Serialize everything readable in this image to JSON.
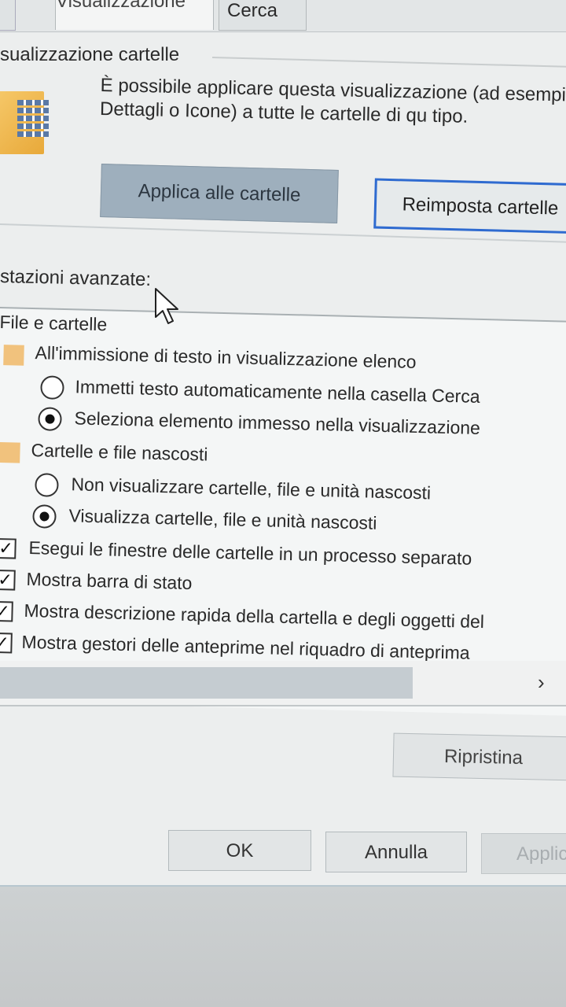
{
  "tabs": [
    {
      "label": ""
    },
    {
      "label": "Visualizzazione"
    },
    {
      "label": "Cerca"
    }
  ],
  "folder_views": {
    "title": "sualizzazione cartelle",
    "description": "È possibile applicare questa visualizzazione (ad esempio Dettagli o Icone) a tutte le cartelle di qu tipo.",
    "apply_button": "Applica alle cartelle",
    "reset_button": "Reimposta cartelle"
  },
  "advanced": {
    "label": "stazioni avanzate:",
    "root": "File e cartelle",
    "items": [
      {
        "type": "category",
        "label": "All'immissione di testo in visualizzazione elenco"
      },
      {
        "type": "radio",
        "checked": false,
        "label": "Immetti testo automaticamente nella casella Cerca"
      },
      {
        "type": "radio",
        "checked": true,
        "label": "Seleziona elemento immesso nella visualizzazione"
      },
      {
        "type": "category",
        "label": "Cartelle e file nascosti"
      },
      {
        "type": "radio",
        "checked": false,
        "label": "Non visualizzare cartelle, file e unità nascosti"
      },
      {
        "type": "radio",
        "checked": true,
        "label": "Visualizza cartelle, file e unità nascosti"
      },
      {
        "type": "checkbox",
        "checked": true,
        "label": "Esegui le finestre delle cartelle in un processo separato"
      },
      {
        "type": "checkbox",
        "checked": true,
        "label": "Mostra barra di stato"
      },
      {
        "type": "checkbox",
        "checked": true,
        "label": "Mostra descrizione rapida della cartella e degli oggetti del"
      },
      {
        "type": "checkbox",
        "checked": true,
        "label": "Mostra gestori delle anteprime nel riquadro di anteprima"
      }
    ],
    "scroll_right": "›",
    "restore_button": "Ripristina"
  },
  "footer": {
    "ok": "OK",
    "cancel": "Annulla",
    "apply": "Applica"
  },
  "colors": {
    "accent": "#2f6bd0",
    "window_bg": "#eceeee"
  }
}
